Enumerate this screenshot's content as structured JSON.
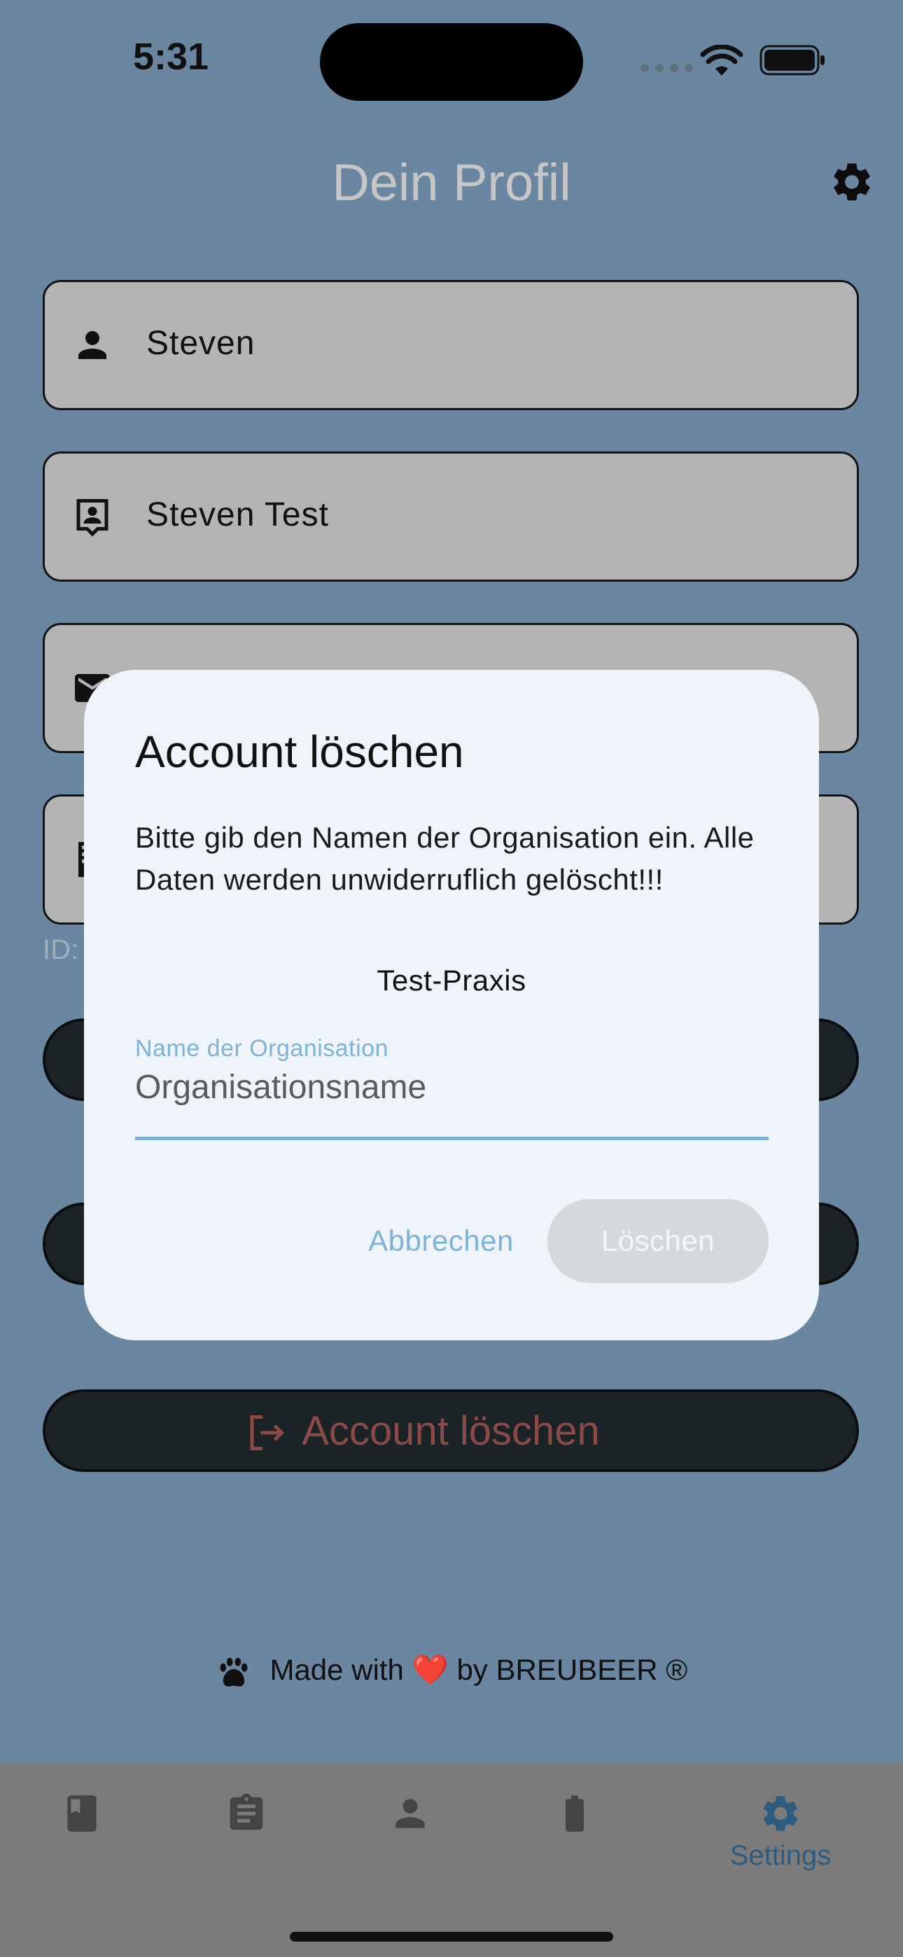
{
  "status_bar": {
    "time": "5:31"
  },
  "header": {
    "title": "Dein Profil",
    "settings_icon": "gear-icon"
  },
  "profile": {
    "first_name": "Steven",
    "full_name": "Steven Test",
    "id_prefix": "ID:"
  },
  "delete_account_button": {
    "label": "Account löschen",
    "icon": "logout-icon"
  },
  "footer": {
    "made_with": "Made with",
    "heart": "❤️",
    "by": "by BREUBEER ®"
  },
  "tab_bar": {
    "items": [
      {
        "icon": "book-icon",
        "label": ""
      },
      {
        "icon": "clipboard-icon",
        "label": ""
      },
      {
        "icon": "person-icon",
        "label": ""
      },
      {
        "icon": "battery-icon",
        "label": ""
      },
      {
        "icon": "gear-icon",
        "label": "Settings",
        "active": true
      }
    ]
  },
  "dialog": {
    "title": "Account löschen",
    "message": "Bitte gib den Namen der Organisation ein. Alle Daten werden unwiderruflich gelöscht!!!",
    "organisation": "Test-Praxis",
    "field_label": "Name der Organisation",
    "field_placeholder": "Organisationsname",
    "field_value": "",
    "cancel_label": "Abbrechen",
    "delete_label": "Löschen"
  },
  "colors": {
    "accent": "#2d5c80",
    "dialog_accent": "#7fb3d6",
    "danger": "#8a4a47",
    "scrim": "#3b5a73"
  }
}
